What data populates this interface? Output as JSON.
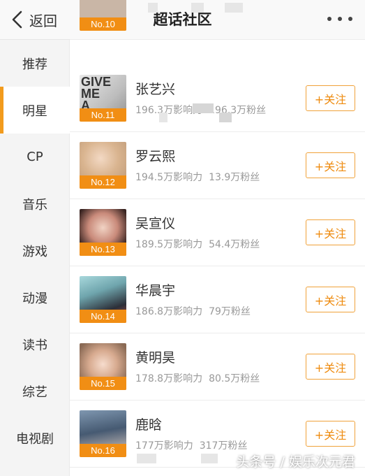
{
  "header": {
    "back_label": "返回",
    "title": "超话社区"
  },
  "sidebar": {
    "items": [
      {
        "label": "推荐"
      },
      {
        "label": "明星",
        "active": true
      },
      {
        "label": "CP"
      },
      {
        "label": "音乐"
      },
      {
        "label": "游戏"
      },
      {
        "label": "动漫"
      },
      {
        "label": "读书"
      },
      {
        "label": "综艺"
      },
      {
        "label": "电视剧"
      }
    ]
  },
  "list": {
    "partial_top_rank": "No.10",
    "follow_label": "+关注",
    "rows": [
      {
        "rank": "No.11",
        "name": "张艺兴",
        "influence": "196.3万影响力",
        "fans": "196.3万粉丝",
        "avatar_text": "GIVE ME A"
      },
      {
        "rank": "No.12",
        "name": "罗云熙",
        "influence": "194.5万影响力",
        "fans": "13.9万粉丝"
      },
      {
        "rank": "No.13",
        "name": "吴宣仪",
        "influence": "189.5万影响力",
        "fans": "54.4万粉丝"
      },
      {
        "rank": "No.14",
        "name": "华晨宇",
        "influence": "186.8万影响力",
        "fans": "79万粉丝"
      },
      {
        "rank": "No.15",
        "name": "黄明昊",
        "influence": "178.8万影响力",
        "fans": "80.5万粉丝"
      },
      {
        "rank": "No.16",
        "name": "鹿晗",
        "influence": "177万影响力",
        "fans": "317万粉丝"
      }
    ]
  },
  "watermark": "头条号 / 娱乐次元君",
  "colors": {
    "accent": "#f29b1d",
    "rank_badge": "#f18e14",
    "follow_text": "#ee8a0d"
  }
}
